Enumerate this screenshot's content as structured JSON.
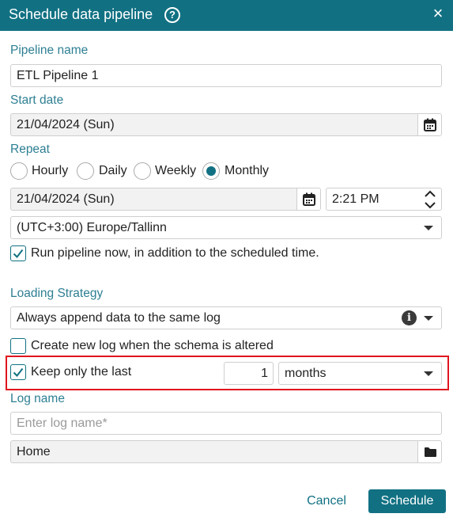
{
  "dialog": {
    "title": "Schedule data pipeline",
    "help_icon": "?",
    "close_icon": "×"
  },
  "pipeline_name": {
    "label": "Pipeline name",
    "value": "ETL Pipeline 1"
  },
  "start_date": {
    "label": "Start date",
    "value": "21/04/2024 (Sun)",
    "icon": "calendar-icon"
  },
  "repeat": {
    "label": "Repeat",
    "options": [
      {
        "label": "Hourly",
        "selected": false
      },
      {
        "label": "Daily",
        "selected": false
      },
      {
        "label": "Weekly",
        "selected": false
      },
      {
        "label": "Monthly",
        "selected": true
      }
    ],
    "date": "21/04/2024 (Sun)",
    "time": "2:21 PM",
    "timezone": "(UTC+3:00) Europe/Tallinn",
    "run_now": {
      "label": "Run pipeline now, in addition to the scheduled time.",
      "checked": true
    }
  },
  "loading_strategy": {
    "label": "Loading Strategy",
    "value": "Always append data to the same log",
    "new_log_on_schema": {
      "label": "Create new log when the schema is altered",
      "checked": false
    },
    "keep_last": {
      "label": "Keep only the last",
      "checked": true,
      "count": "1",
      "unit": "months"
    }
  },
  "log_name": {
    "label": "Log name",
    "placeholder": "Enter log name*",
    "folder": "Home",
    "icon": "folder-icon"
  },
  "footer": {
    "cancel_label": "Cancel",
    "schedule_label": "Schedule"
  },
  "colors": {
    "accent": "#117183",
    "label": "#2e7f93",
    "highlight": "#e0141e"
  }
}
